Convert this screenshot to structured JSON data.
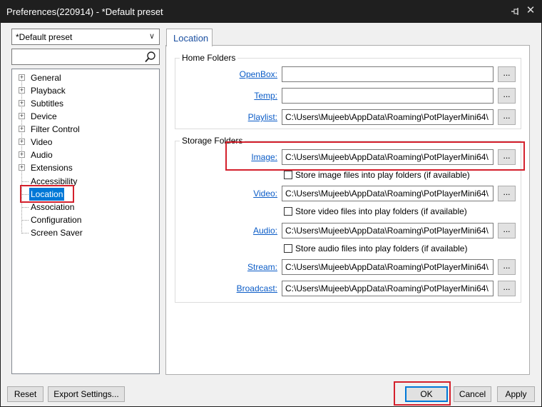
{
  "window": {
    "title": "Preferences(220914) - *Default preset",
    "close_glyph": "✕"
  },
  "sidebar": {
    "preset_value": "*Default preset",
    "search_placeholder": "",
    "tree": [
      {
        "label": "General",
        "expandable": true
      },
      {
        "label": "Playback",
        "expandable": true
      },
      {
        "label": "Subtitles",
        "expandable": true
      },
      {
        "label": "Device",
        "expandable": true
      },
      {
        "label": "Filter Control",
        "expandable": true
      },
      {
        "label": "Video",
        "expandable": true
      },
      {
        "label": "Audio",
        "expandable": true
      },
      {
        "label": "Extensions",
        "expandable": true
      },
      {
        "label": "Accessibility",
        "expandable": false
      },
      {
        "label": "Location",
        "expandable": false,
        "selected": true
      },
      {
        "label": "Association",
        "expandable": false
      },
      {
        "label": "Configuration",
        "expandable": false
      },
      {
        "label": "Screen Saver",
        "expandable": false
      }
    ]
  },
  "tab": {
    "label": "Location"
  },
  "home_folders": {
    "title": "Home Folders",
    "rows": [
      {
        "label": "OpenBox:",
        "value": ""
      },
      {
        "label": "Temp:",
        "value": ""
      },
      {
        "label": "Playlist:",
        "value": "C:\\Users\\Mujeeb\\AppData\\Roaming\\PotPlayerMini64\\"
      }
    ]
  },
  "storage_folders": {
    "title": "Storage Folders",
    "rows": [
      {
        "label": "Image:",
        "value": "C:\\Users\\Mujeeb\\AppData\\Roaming\\PotPlayerMini64\\",
        "checkbox": "Store image files into play folders (if available)"
      },
      {
        "label": "Video:",
        "value": "C:\\Users\\Mujeeb\\AppData\\Roaming\\PotPlayerMini64\\",
        "checkbox": "Store video files into play folders (if available)"
      },
      {
        "label": "Audio:",
        "value": "C:\\Users\\Mujeeb\\AppData\\Roaming\\PotPlayerMini64\\",
        "checkbox": "Store audio files into play folders (if available)"
      },
      {
        "label": "Stream:",
        "value": "C:\\Users\\Mujeeb\\AppData\\Roaming\\PotPlayerMini64\\"
      },
      {
        "label": "Broadcast:",
        "value": "C:\\Users\\Mujeeb\\AppData\\Roaming\\PotPlayerMini64\\"
      }
    ]
  },
  "browse_label": "...",
  "footer": {
    "reset": "Reset",
    "export": "Export Settings...",
    "ok": "OK",
    "cancel": "Cancel",
    "apply": "Apply"
  },
  "colors": {
    "titlebar": "#1f1f1f",
    "link": "#0b5cc7",
    "highlight": "#d4202c",
    "selection": "#0078d7"
  }
}
